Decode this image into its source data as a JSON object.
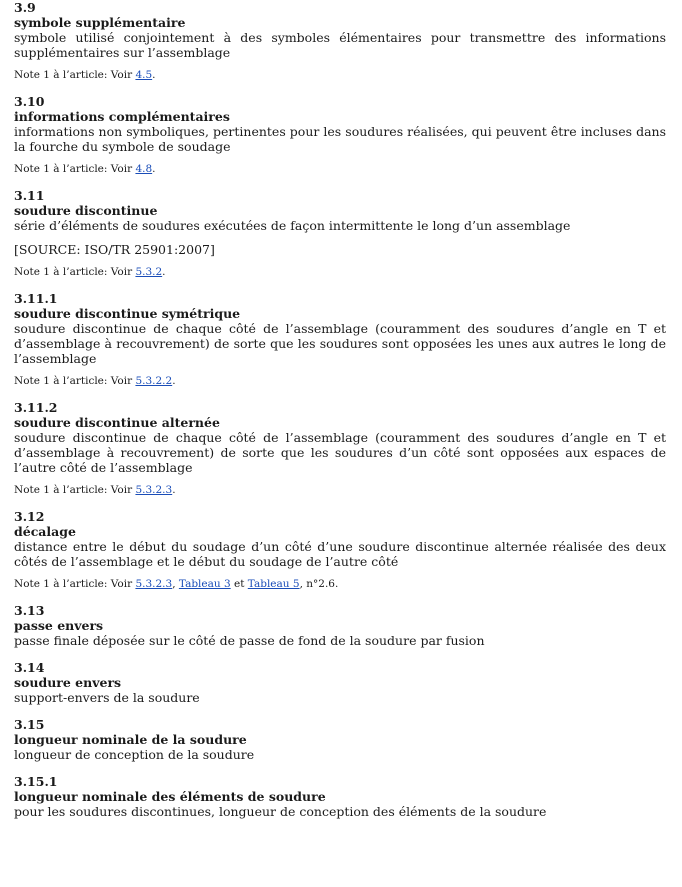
{
  "note_prefix": "Note 1 à l’article: Voir ",
  "entries": [
    {
      "number": "3.9",
      "term": "symbole supplémentaire",
      "definition": "symbole utilisé conjointement à des symboles élémentaires pour transmettre des informations supplémentaires sur l’assemblage",
      "note_ref1": "4.5",
      "note_tail": "."
    },
    {
      "number": "3.10",
      "term": "informations complémentaires",
      "definition": "informations non symboliques, pertinentes pour les soudures réalisées, qui peuvent être incluses dans la fourche du symbole de soudage",
      "note_ref1": "4.8",
      "note_tail": "."
    },
    {
      "number": "3.11",
      "term": "soudure discontinue",
      "definition": "série d’éléments de soudures exécutées de façon intermittente le long d’un assemblage",
      "source": "[SOURCE: ISO/TR 25901:2007]",
      "note_ref1": "5.3.2",
      "note_tail": "."
    },
    {
      "number": "3.11.1",
      "term": "soudure discontinue symétrique",
      "definition": "soudure discontinue de chaque côté de l’assemblage (couramment des soudures d’angle en T et d’assemblage à recouvrement) de sorte que les soudures sont opposées les unes aux autres le long de l’assemblage",
      "note_ref1": "5.3.2.2",
      "note_tail": "."
    },
    {
      "number": "3.11.2",
      "term": "soudure discontinue alternée",
      "definition": "soudure discontinue de chaque côté de l’assemblage (couramment des soudures d’angle en T et d’assemblage à recouvrement) de sorte que les soudures d’un côté sont opposées aux espaces de l’autre côté de l’assemblage",
      "note_ref1": "5.3.2.3",
      "note_tail": "."
    },
    {
      "number": "3.12",
      "term": "décalage",
      "definition": "distance entre le début du soudage d’un côté d’une soudure discontinue alternée réalisée des deux côtés de l’assemblage et le début du soudage de l’autre côté",
      "note_ref1": "5.3.2.3",
      "note_sep1": ", ",
      "note_ref2": "Tableau 3",
      "note_sep2": " et ",
      "note_ref3": "Tableau 5",
      "note_tail": ", n°2.6."
    },
    {
      "number": "3.13",
      "term": "passe envers",
      "definition": "passe finale déposée sur le côté de passe de fond de la soudure par fusion"
    },
    {
      "number": "3.14",
      "term": "soudure envers",
      "definition": "support-envers de la soudure"
    },
    {
      "number": "3.15",
      "term": "longueur nominale de la soudure",
      "definition": "longueur de conception de la soudure"
    },
    {
      "number": "3.15.1",
      "term": "longueur nominale des éléments de soudure",
      "definition": "pour les soudures discontinues, longueur de conception des éléments de la soudure"
    }
  ]
}
